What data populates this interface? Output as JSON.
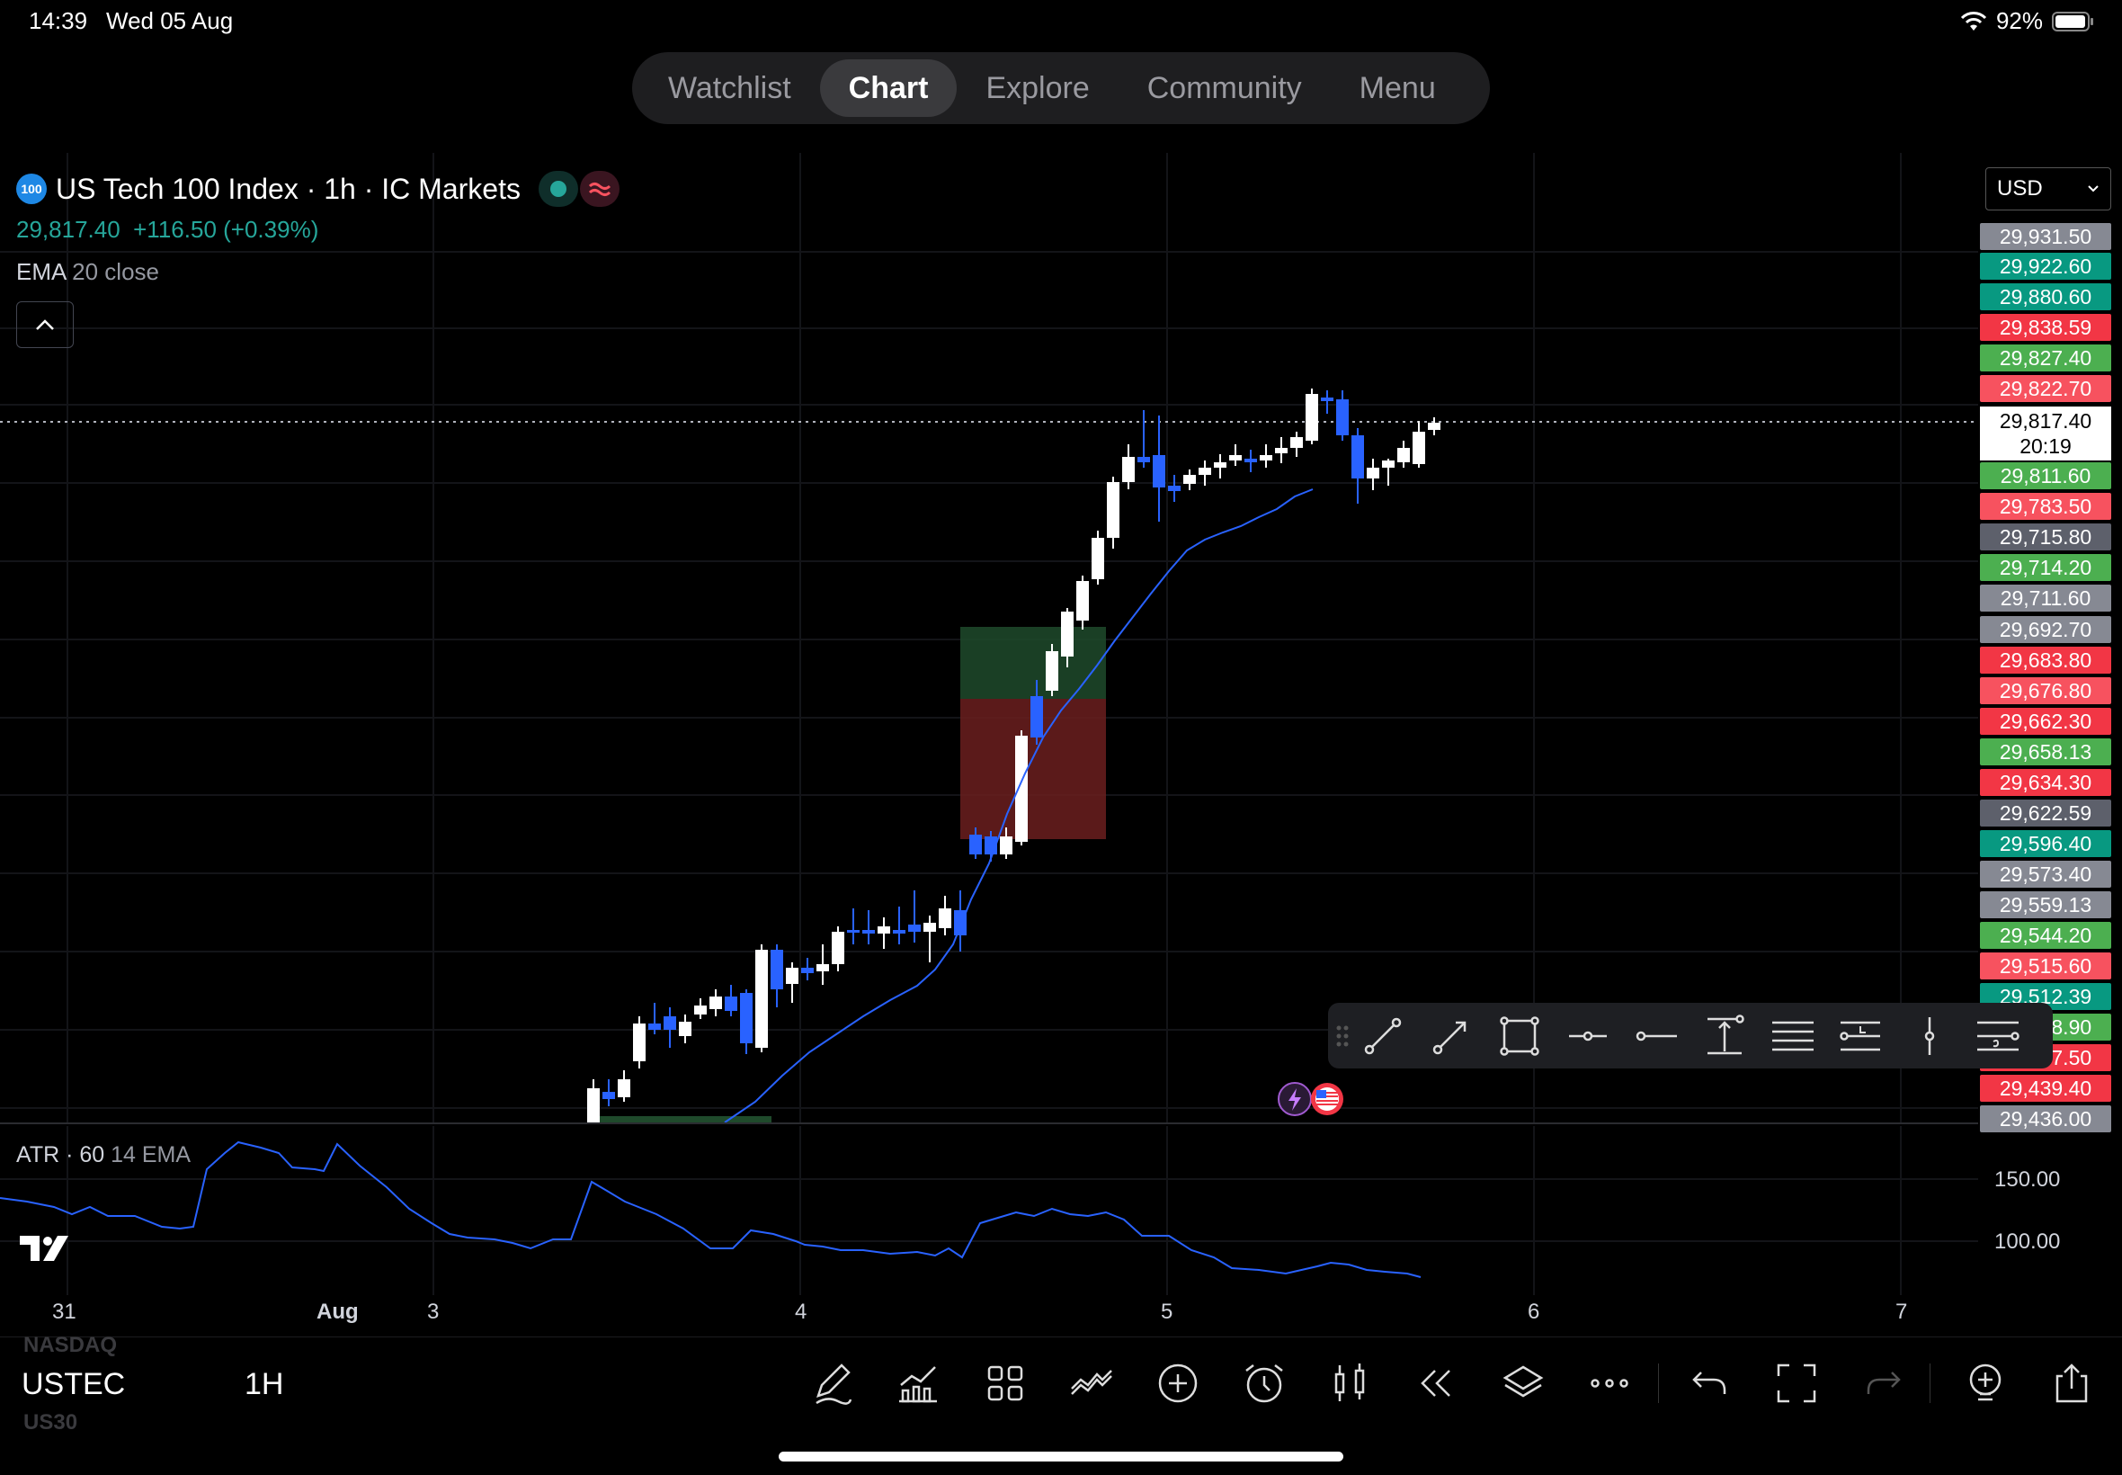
{
  "status_bar": {
    "time": "14:39",
    "date": "Wed 05 Aug",
    "battery": "92%"
  },
  "nav": {
    "tabs": [
      "Watchlist",
      "Chart",
      "Explore",
      "Community",
      "Menu"
    ],
    "active": "Chart"
  },
  "header": {
    "logo_text": "100",
    "title": "US Tech 100 Index · 1h · IC Markets",
    "price": "29,817.40",
    "change": "+116.50 (+0.39%)",
    "indicator_name": "EMA",
    "indicator_params": "20 close",
    "currency": "USD"
  },
  "price_scale": [
    {
      "label": "29,931.50",
      "color": "#868993"
    },
    {
      "label": "29,922.60",
      "color": "#089981"
    },
    {
      "label": "29,880.60",
      "color": "#089981"
    },
    {
      "label": "29,838.59",
      "color": "#f23645"
    },
    {
      "label": "29,827.40",
      "color": "#4caf50"
    },
    {
      "label": "29,822.70",
      "color": "#f7525f"
    },
    {
      "label": "29,811.60",
      "color": "#4caf50"
    },
    {
      "label": "29,783.50",
      "color": "#f7525f"
    },
    {
      "label": "29,715.80",
      "color": "#5d606b"
    },
    {
      "label": "29,714.20",
      "color": "#4caf50"
    },
    {
      "label": "29,711.60",
      "color": "#868993"
    },
    {
      "label": "29,692.70",
      "color": "#868993"
    },
    {
      "label": "29,683.80",
      "color": "#f23645"
    },
    {
      "label": "29,676.80",
      "color": "#f7525f"
    },
    {
      "label": "29,662.30",
      "color": "#f23645"
    },
    {
      "label": "29,658.13",
      "color": "#4caf50"
    },
    {
      "label": "29,634.30",
      "color": "#f23645"
    },
    {
      "label": "29,622.59",
      "color": "#5d606b"
    },
    {
      "label": "29,596.40",
      "color": "#089981"
    },
    {
      "label": "29,573.40",
      "color": "#868993"
    },
    {
      "label": "29,559.13",
      "color": "#868993"
    },
    {
      "label": "29,544.20",
      "color": "#4caf50"
    },
    {
      "label": "29,515.60",
      "color": "#f7525f"
    },
    {
      "label": "29,512.39",
      "color": "#089981"
    },
    {
      "label": "29,478.90",
      "color": "#4caf50"
    },
    {
      "label": "29,457.50",
      "color": "#f23645"
    },
    {
      "label": "29,439.40",
      "color": "#f23645"
    },
    {
      "label": "29,436.00",
      "color": "#868993"
    }
  ],
  "current_price": {
    "price": "29,817.40",
    "countdown": "20:19"
  },
  "atr": {
    "name": "ATR · 60",
    "params": "14 EMA",
    "scale": [
      "150.00",
      "100.00"
    ]
  },
  "time_axis": [
    "31",
    "Aug",
    "3",
    "4",
    "5",
    "6",
    "7"
  ],
  "bottom": {
    "symbol_prev": "NASDAQ",
    "symbol": "USTEC",
    "symbol_next": "US30",
    "interval": "1H"
  },
  "colors": {
    "up": "#ffffff",
    "down": "#2962ff",
    "ema": "#2962ff",
    "background": "#000000"
  }
}
